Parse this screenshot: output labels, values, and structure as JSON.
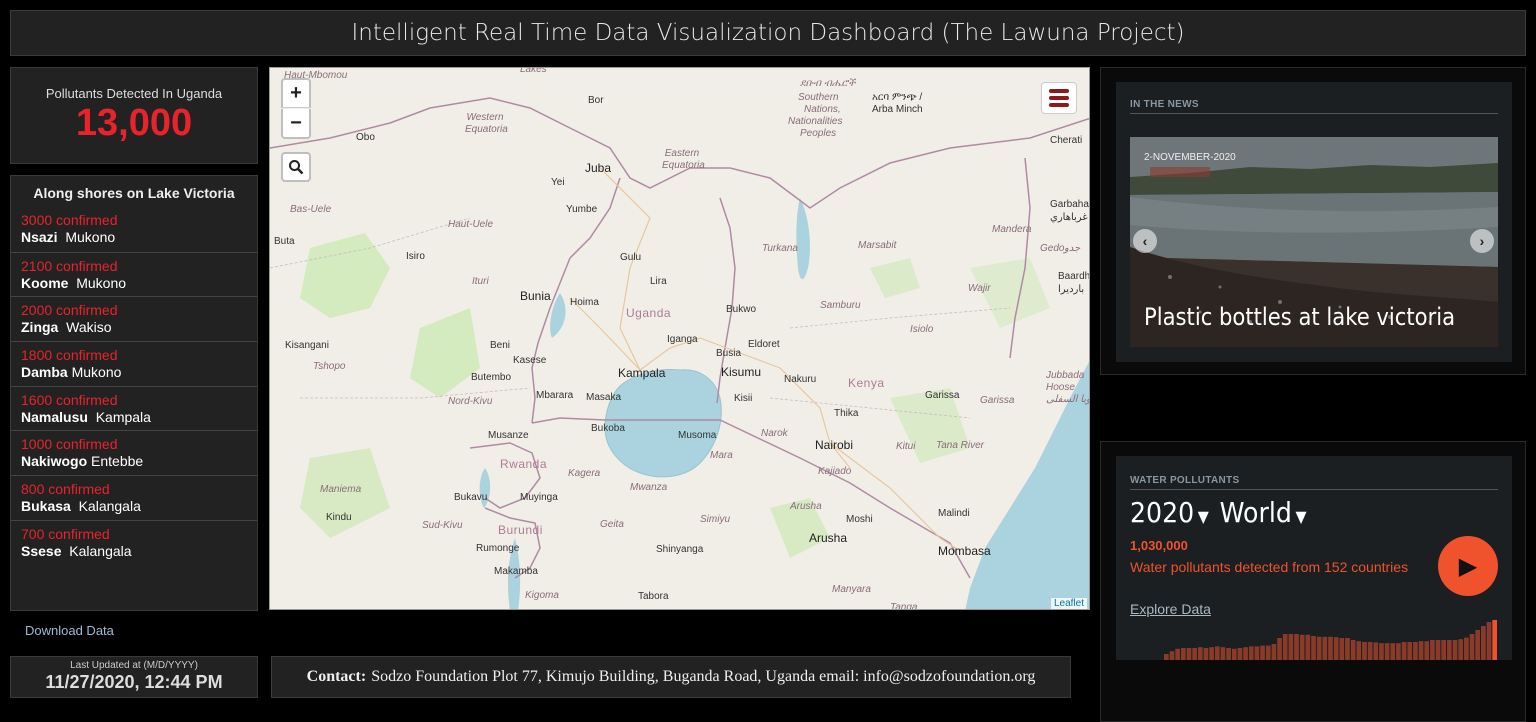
{
  "header": {
    "title": "Intelligent Real Time Data Visualization Dashboard (The Lawuna Project)"
  },
  "pollutants": {
    "label": "Pollutants Detected In Uganda",
    "value": "13,000"
  },
  "shores": {
    "heading": "Along shores on Lake Victoria",
    "items": [
      {
        "confirmed": "3000 confirmed",
        "place": "Nsazi",
        "district": "Mukono"
      },
      {
        "confirmed": "2100 confirmed",
        "place": "Koome",
        "district": "Mukono"
      },
      {
        "confirmed": "2000 confirmed",
        "place": "Zinga",
        "district": "Wakiso"
      },
      {
        "confirmed": "1800 confirmed",
        "place": "Damba",
        "district": "Mukono"
      },
      {
        "confirmed": "1600 confirmed",
        "place": "Namalusu",
        "district": "Kampala"
      },
      {
        "confirmed": "1000 confirmed",
        "place": "Nakiwogo",
        "district": "Entebbe"
      },
      {
        "confirmed": "800 confirmed",
        "place": "Bukasa",
        "district": "Kalangala"
      },
      {
        "confirmed": "700 confirmed",
        "place": "Ssese",
        "district": "Kalangala"
      }
    ]
  },
  "download": {
    "label": "Download Data"
  },
  "updated": {
    "label": "Last Updated at (M/D/YYYY)",
    "value": "11/27/2020, 12:44 PM"
  },
  "contact": {
    "label": "Contact:",
    "text": "Sodzo Foundation Plot 77, Kimujo Building, Buganda Road, Uganda email: info@sodzofoundation.org"
  },
  "map": {
    "zoom_in": "+",
    "zoom_out": "−",
    "attribution": "Leaflet",
    "labels": {
      "haut_mbomou": "Haut-Mbomou",
      "lakes": "Lakes",
      "western_equatoria": "Western Equatoria",
      "bor": "Bor",
      "obo": "Obo",
      "eastern_equatoria": "Eastern Equatoria",
      "juba": "Juba",
      "yei": "Yei",
      "yumbe": "Yumbe",
      "bas_uele": "Bas-Uele",
      "haut_uele": "Haut-Uele",
      "buta": "Buta",
      "isiro": "Isiro",
      "gulu": "Gulu",
      "ituri": "Ituri",
      "lira": "Lira",
      "bunia": "Bunia",
      "hoima": "Hoima",
      "uganda": "Uganda",
      "bukwo": "Bukwo",
      "kisangani": "Kisangani",
      "beni": "Beni",
      "kasese": "Kasese",
      "iganga": "Iganga",
      "busia": "Busia",
      "eldoret": "Eldoret",
      "tshopo": "Tshopo",
      "butembo": "Butembo",
      "kampala": "Kampala",
      "kisumu": "Kisumu",
      "nakuru": "Nakuru",
      "kenya": "Kenya",
      "mbarara": "Mbarara",
      "masaka": "Masaka",
      "kisii": "Kisii",
      "nord_kivu": "Nord-Kivu",
      "bukoba": "Bukoba",
      "musoma": "Musoma",
      "musanze": "Musanze",
      "narok": "Narok",
      "nairobi": "Nairobi",
      "thika": "Thika",
      "rwanda": "Rwanda",
      "kagera": "Kagera",
      "mara": "Mara",
      "maniema": "Maniema",
      "mwanza": "Mwanza",
      "kajiado": "Kajiado",
      "bukavu": "Bukavu",
      "muyinga": "Muyinga",
      "kindu": "Kindu",
      "sud_kivu": "Sud-Kivu",
      "burundi": "Burundi",
      "geita": "Geita",
      "simiyu": "Simiyu",
      "arusha_region": "Arusha",
      "moshi": "Moshi",
      "arusha": "Arusha",
      "malindi": "Malindi",
      "rumonge": "Rumonge",
      "shinyanga": "Shinyanga",
      "mombasa": "Mombasa",
      "makamba": "Makamba",
      "kigoma": "Kigoma",
      "manyara": "Manyara",
      "tabora": "Tabora",
      "tanga": "Tanga",
      "turkana": "Turkana",
      "marsabit": "Marsabit",
      "samburu": "Samburu",
      "isiolo": "Isiolo",
      "wajir": "Wajir",
      "mandera": "Mandera",
      "garissa": "Garissa",
      "garissa_region": "Garissa",
      "kitui": "Kitui",
      "tana_river": "Tana River",
      "cherati": "Cherati",
      "garbaha": "Garbaha",
      "garbaha_ar": "غرباهاري",
      "gedo": "Gedo",
      "gedo_ar": "جدو",
      "baardh": "Baardh",
      "baardh_ar": "بارديرا",
      "jubbada_hoose": "Jubbada Hoose",
      "jubbada_ar": "جوبا السفلى",
      "sn_line1": "Southern",
      "sn_line2": "Nations,",
      "sn_line3": "Nationalities",
      "sn_line4": "Peoples",
      "arba_minch": "Arba Minch",
      "arba_minch_am": "አርባ ምንጭ /",
      "ethiopic": "ደቡብ ብሔሮች"
    }
  },
  "news": {
    "section": "IN THE NEWS",
    "date": "2-NOVEMBER-2020",
    "caption": "Plastic bottles at lake victoria",
    "prev": "‹",
    "next": "›"
  },
  "water": {
    "section": "WATER POLLUTANTS",
    "year": "2020",
    "region": "World",
    "count": "1,030,000",
    "description": "Water pollutants detected from 152 countries",
    "play": "▶",
    "explore": "Explore Data",
    "bars": [
      0.15,
      0.22,
      0.28,
      0.3,
      0.3,
      0.3,
      0.32,
      0.3,
      0.32,
      0.34,
      0.32,
      0.3,
      0.28,
      0.3,
      0.32,
      0.34,
      0.34,
      0.36,
      0.36,
      0.4,
      0.55,
      0.65,
      0.65,
      0.65,
      0.63,
      0.63,
      0.6,
      0.58,
      0.58,
      0.58,
      0.57,
      0.55,
      0.55,
      0.5,
      0.47,
      0.45,
      0.45,
      0.44,
      0.42,
      0.42,
      0.42,
      0.42,
      0.45,
      0.45,
      0.45,
      0.47,
      0.47,
      0.5,
      0.5,
      0.5,
      0.5,
      0.5,
      0.52,
      0.56,
      0.65,
      0.75,
      0.85,
      0.95,
      1.0
    ]
  }
}
